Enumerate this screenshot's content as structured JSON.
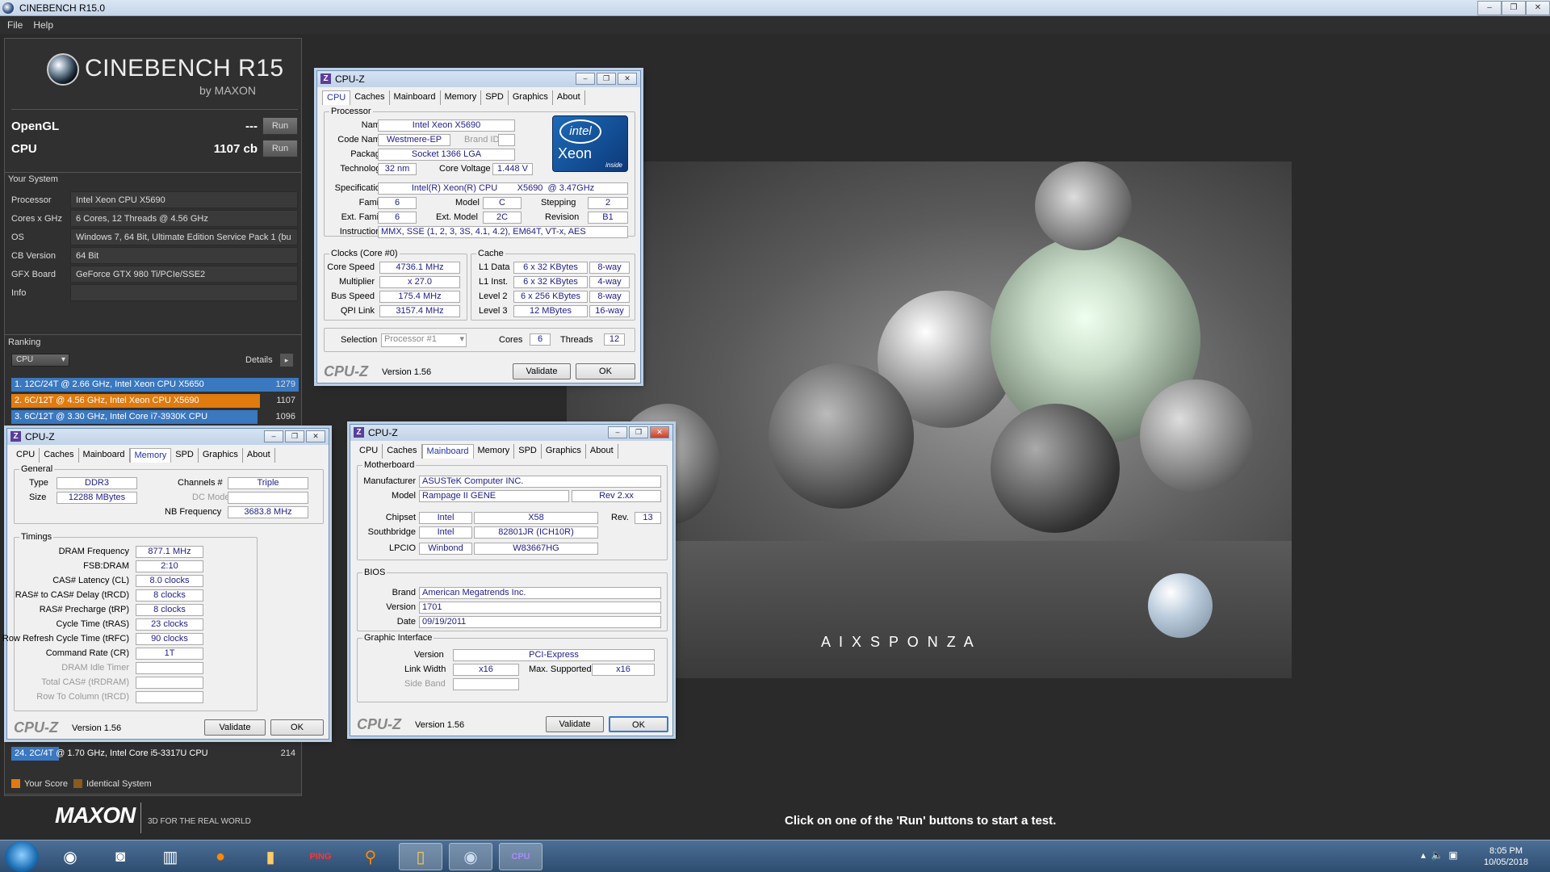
{
  "window": {
    "title": "CINEBENCH R15.0",
    "min": "‒",
    "max": "❐",
    "close": "✕"
  },
  "menu": [
    "File",
    "Help"
  ],
  "cinebench": {
    "logo_name": "CINEBENCH R15",
    "logo_by": "by MAXON",
    "opengl_label": "OpenGL",
    "opengl_value": "---",
    "cpu_label": "CPU",
    "cpu_value": "1107 cb",
    "run": "Run",
    "your_system": "Your System",
    "system": [
      {
        "k": "Processor",
        "v": "Intel Xeon CPU X5690"
      },
      {
        "k": "Cores x GHz",
        "v": "6 Cores, 12 Threads @ 4.56 GHz"
      },
      {
        "k": "OS",
        "v": "Windows 7, 64 Bit, Ultimate Edition Service Pack 1 (bu"
      },
      {
        "k": "CB Version",
        "v": "64 Bit"
      },
      {
        "k": "GFX Board",
        "v": "GeForce GTX 980 Ti/PCIe/SSE2"
      },
      {
        "k": "Info",
        "v": ""
      }
    ],
    "ranking": "Ranking",
    "rank_select": "CPU",
    "details": "Details",
    "rank_rows": [
      {
        "t": "1. 12C/24T @ 2.66 GHz, Intel Xeon CPU X5650",
        "s": "1279",
        "color": "#3a78c0",
        "frac": 1.0
      },
      {
        "t": "2. 6C/12T @ 4.56 GHz, Intel Xeon CPU X5690",
        "s": "1107",
        "color": "#e07b10",
        "frac": 0.866
      },
      {
        "t": "3. 6C/12T @ 3.30 GHz,  Intel Core i7-3930K CPU",
        "s": "1096",
        "color": "#3a78c0",
        "frac": 0.857
      },
      {
        "t": "24. 2C/4T @ 1.70 GHz,  Intel Core i5-3317U CPU",
        "s": "214",
        "color": "#3a78c0",
        "frac": 0.167
      }
    ],
    "legend_your": "Your Score",
    "legend_identical": "Identical System",
    "hint": "Click on one of the 'Run' buttons to start a test.",
    "maxon": "MAXON",
    "maxon_tag": "3D FOR THE REAL WORLD",
    "aixsponza": "A I X S P O N Z A"
  },
  "cpuz_common": {
    "title": "CPU-Z",
    "logo": "CPU-Z",
    "version": "Version 1.56",
    "validate": "Validate",
    "ok": "OK",
    "tabs": [
      "CPU",
      "Caches",
      "Mainboard",
      "Memory",
      "SPD",
      "Graphics",
      "About"
    ]
  },
  "cpu": {
    "processor": "Processor",
    "name_l": "Name",
    "name": "Intel Xeon X5690",
    "codename_l": "Code Name",
    "codename": "Westmere-EP",
    "brandid_l": "Brand ID",
    "package_l": "Package",
    "package": "Socket 1366 LGA",
    "tech_l": "Technology",
    "tech": "32 nm",
    "cv_l": "Core Voltage",
    "cv": "1.448 V",
    "spec_l": "Specification",
    "spec": "Intel(R) Xeon(R) CPU        X5690  @ 3.47GHz",
    "family_l": "Family",
    "family": "6",
    "model_l": "Model",
    "model": "C",
    "stepping_l": "Stepping",
    "stepping": "2",
    "extfam_l": "Ext. Family",
    "extfam": "6",
    "extmod_l": "Ext. Model",
    "extmod": "2C",
    "rev_l": "Revision",
    "rev": "B1",
    "instr_l": "Instructions",
    "instr": "MMX, SSE (1, 2, 3, 3S, 4.1, 4.2), EM64T, VT-x, AES",
    "clocks": "Clocks (Core #0)",
    "cs_l": "Core Speed",
    "cs": "4736.1 MHz",
    "mul_l": "Multiplier",
    "mul": "x 27.0",
    "bus_l": "Bus Speed",
    "bus": "175.4 MHz",
    "qpi_l": "QPI Link",
    "qpi": "3157.4 MHz",
    "cache": "Cache",
    "l1d_l": "L1 Data",
    "l1d": "6 x 32 KBytes",
    "l1d_w": "8-way",
    "l1i_l": "L1 Inst.",
    "l1i": "6 x 32 KBytes",
    "l1i_w": "4-way",
    "l2_l": "Level 2",
    "l2": "6 x 256 KBytes",
    "l2_w": "8-way",
    "l3_l": "Level 3",
    "l3": "12 MBytes",
    "l3_w": "16-way",
    "sel_l": "Selection",
    "sel": "Processor #1",
    "cores_l": "Cores",
    "cores": "6",
    "threads_l": "Threads",
    "threads": "12",
    "intel": "intel",
    "xeon": "Xeon",
    "inside": "inside"
  },
  "mem": {
    "general": "General",
    "type_l": "Type",
    "type": "DDR3",
    "size_l": "Size",
    "size": "12288 MBytes",
    "ch_l": "Channels #",
    "ch": "Triple",
    "dc_l": "DC Mode",
    "nb_l": "NB Frequency",
    "nb": "3683.8 MHz",
    "timings": "Timings",
    "rows": [
      {
        "k": "DRAM Frequency",
        "v": "877.1 MHz",
        "dis": false
      },
      {
        "k": "FSB:DRAM",
        "v": "2:10",
        "dis": false
      },
      {
        "k": "CAS# Latency (CL)",
        "v": "8.0 clocks",
        "dis": false
      },
      {
        "k": "RAS# to CAS# Delay (tRCD)",
        "v": "8 clocks",
        "dis": false
      },
      {
        "k": "RAS# Precharge (tRP)",
        "v": "8 clocks",
        "dis": false
      },
      {
        "k": "Cycle Time (tRAS)",
        "v": "23 clocks",
        "dis": false
      },
      {
        "k": "Row Refresh Cycle Time (tRFC)",
        "v": "90 clocks",
        "dis": false
      },
      {
        "k": "Command Rate (CR)",
        "v": "1T",
        "dis": false
      },
      {
        "k": "DRAM Idle Timer",
        "v": "",
        "dis": true
      },
      {
        "k": "Total CAS# (tRDRAM)",
        "v": "",
        "dis": true
      },
      {
        "k": "Row To Column (tRCD)",
        "v": "",
        "dis": true
      }
    ]
  },
  "mb": {
    "motherboard": "Motherboard",
    "manu_l": "Manufacturer",
    "manu": "ASUSTeK Computer INC.",
    "model_l": "Model",
    "model": "Rampage II GENE",
    "rev2": "Rev 2.xx",
    "chipset_l": "Chipset",
    "chipset_v": "Intel",
    "chipset_m": "X58",
    "rev_l": "Rev.",
    "rev": "13",
    "sb_l": "Southbridge",
    "sb_v": "Intel",
    "sb_m": "82801JR (ICH10R)",
    "lpcio_l": "LPCIO",
    "lpcio_v": "Winbond",
    "lpcio_m": "W83667HG",
    "bios": "BIOS",
    "brand_l": "Brand",
    "brand": "American Megatrends Inc.",
    "version_l": "Version",
    "version": "1701",
    "date_l": "Date",
    "date": "09/19/2011",
    "gi": "Graphic Interface",
    "giv_l": "Version",
    "giv": "PCI-Express",
    "lw_l": "Link Width",
    "lw": "x16",
    "ms_l": "Max. Supported",
    "ms": "x16",
    "sb2_l": "Side Band"
  },
  "taskbar": {
    "time": "8:05 PM",
    "date": "10/05/2018",
    "ping": "PING"
  }
}
